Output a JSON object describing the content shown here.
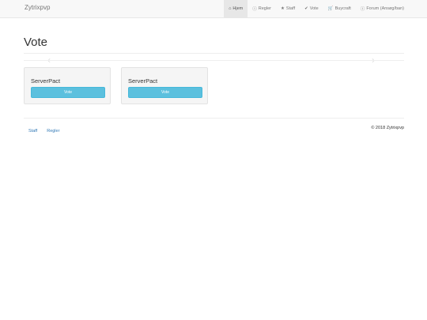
{
  "navbar": {
    "brand": "Zytrixpvp",
    "items": [
      {
        "icon": "home-icon",
        "glyph": "⌂",
        "label": "Hjem",
        "active": true
      },
      {
        "icon": "info-icon",
        "glyph": "ⓘ",
        "label": "Regler"
      },
      {
        "icon": "star-icon",
        "glyph": "★",
        "label": "Staff"
      },
      {
        "icon": "check-icon",
        "glyph": "✔",
        "label": "Vote"
      },
      {
        "icon": "cart-icon",
        "glyph": "🛒",
        "label": "Buycraft"
      },
      {
        "icon": "info-icon",
        "glyph": "ⓘ",
        "label": "Forum (Ansøg/ban)"
      }
    ]
  },
  "main": {
    "title": "Vote",
    "carousel": {
      "prev_glyph": "‹",
      "next_glyph": "›"
    },
    "cards": [
      {
        "title": "ServerPact",
        "button": "Vote"
      },
      {
        "title": "ServerPact",
        "button": "Vote"
      }
    ]
  },
  "footer": {
    "links": [
      "Staff",
      "Regler"
    ],
    "copyright": "© 2018 Zytrixpvp"
  },
  "colors": {
    "vote_button": "#5bc0de",
    "link": "#337ab7",
    "navbar_bg": "#f8f8f8"
  }
}
